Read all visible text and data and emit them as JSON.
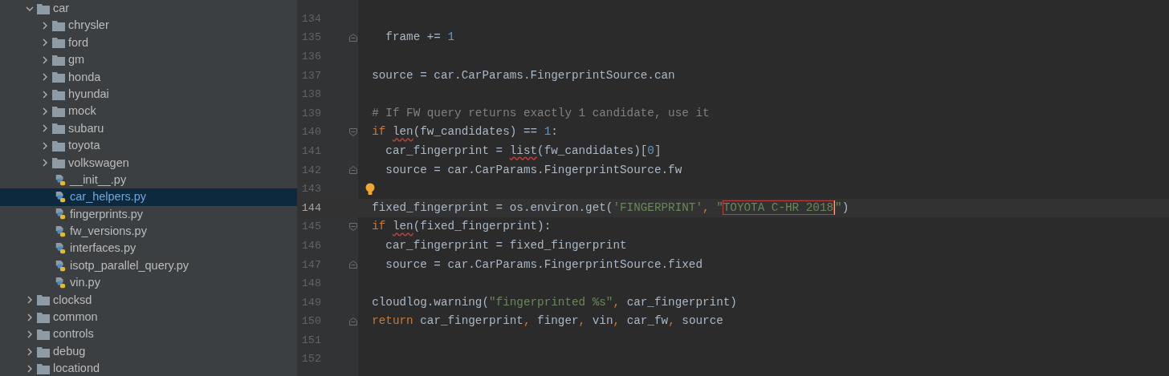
{
  "project_tree": [
    {
      "kind": "folder",
      "label": "car",
      "expanded": true,
      "selected": false,
      "children": [
        {
          "kind": "folder",
          "label": "chrysler",
          "expanded": false,
          "selected": false
        },
        {
          "kind": "folder",
          "label": "ford",
          "expanded": false,
          "selected": false
        },
        {
          "kind": "folder",
          "label": "gm",
          "expanded": false,
          "selected": false
        },
        {
          "kind": "folder",
          "label": "honda",
          "expanded": false,
          "selected": false
        },
        {
          "kind": "folder",
          "label": "hyundai",
          "expanded": false,
          "selected": false
        },
        {
          "kind": "folder",
          "label": "mock",
          "expanded": false,
          "selected": false
        },
        {
          "kind": "folder",
          "label": "subaru",
          "expanded": false,
          "selected": false
        },
        {
          "kind": "folder",
          "label": "toyota",
          "expanded": false,
          "selected": false
        },
        {
          "kind": "folder",
          "label": "volkswagen",
          "expanded": false,
          "selected": false
        },
        {
          "kind": "file",
          "label": "__init__.py",
          "selected": false
        },
        {
          "kind": "file",
          "label": "car_helpers.py",
          "selected": true
        },
        {
          "kind": "file",
          "label": "fingerprints.py",
          "selected": false
        },
        {
          "kind": "file",
          "label": "fw_versions.py",
          "selected": false
        },
        {
          "kind": "file",
          "label": "interfaces.py",
          "selected": false
        },
        {
          "kind": "file",
          "label": "isotp_parallel_query.py",
          "selected": false
        },
        {
          "kind": "file",
          "label": "vin.py",
          "selected": false
        }
      ]
    },
    {
      "kind": "folder",
      "label": "clocksd",
      "expanded": false,
      "selected": false
    },
    {
      "kind": "folder",
      "label": "common",
      "expanded": false,
      "selected": false
    },
    {
      "kind": "folder",
      "label": "controls",
      "expanded": false,
      "selected": false
    },
    {
      "kind": "folder",
      "label": "debug",
      "expanded": false,
      "selected": false
    },
    {
      "kind": "folder",
      "label": "locationd",
      "expanded": false,
      "selected": false
    }
  ],
  "editor": {
    "lines": [
      {
        "number": "134",
        "current": false
      },
      {
        "number": "135",
        "current": false,
        "fold_marker": {
          "kind": "end"
        },
        "tokens": [
          {
            "kind": "plain",
            "text": "    frame += "
          },
          {
            "kind": "number",
            "text": "1"
          }
        ]
      },
      {
        "number": "136",
        "current": false
      },
      {
        "number": "137",
        "current": false,
        "tokens": [
          {
            "kind": "plain",
            "text": "  source = car.CarParams.FingerprintSource.can"
          }
        ]
      },
      {
        "number": "138",
        "current": false
      },
      {
        "number": "139",
        "current": false,
        "tokens": [
          {
            "kind": "comment",
            "text": "  # If FW query returns exactly 1 candidate, use it"
          }
        ]
      },
      {
        "number": "140",
        "current": false,
        "fold_marker": {
          "kind": "start"
        },
        "tokens": [
          {
            "kind": "keyword",
            "text": "  if "
          },
          {
            "kind": "warned",
            "text": "len"
          },
          {
            "kind": "plain",
            "text": "(fw_candidates) == "
          },
          {
            "kind": "number",
            "text": "1"
          },
          {
            "kind": "plain",
            "text": ":"
          }
        ]
      },
      {
        "number": "141",
        "current": false,
        "tokens": [
          {
            "kind": "plain",
            "text": "    car_fingerprint = "
          },
          {
            "kind": "warned",
            "text": "list"
          },
          {
            "kind": "plain",
            "text": "(fw_candidates)["
          },
          {
            "kind": "number",
            "text": "0"
          },
          {
            "kind": "plain",
            "text": "]"
          }
        ]
      },
      {
        "number": "142",
        "current": false,
        "fold_marker": {
          "kind": "end"
        },
        "tokens": [
          {
            "kind": "plain",
            "text": "    source = car.CarParams.FingerprintSource.fw"
          }
        ]
      },
      {
        "number": "143",
        "current": false,
        "hint": true
      },
      {
        "number": "144",
        "current": true,
        "tokens": [
          {
            "kind": "plain",
            "text": "  fixed_fingerprint = os.environ.get("
          },
          {
            "kind": "string",
            "text": "'FINGERPRINT'"
          },
          {
            "kind": "keyword",
            "text": ", "
          },
          {
            "kind": "string",
            "text": "\""
          },
          {
            "kind": "flagged",
            "text": "TOYOTA C-HR 2018",
            "caret_after": true
          },
          {
            "kind": "string",
            "text": "\""
          },
          {
            "kind": "plain",
            "text": ")"
          }
        ]
      },
      {
        "number": "145",
        "current": false,
        "fold_marker": {
          "kind": "start"
        },
        "tokens": [
          {
            "kind": "keyword",
            "text": "  if "
          },
          {
            "kind": "warned",
            "text": "len"
          },
          {
            "kind": "plain",
            "text": "(fixed_fingerprint):"
          }
        ]
      },
      {
        "number": "146",
        "current": false,
        "tokens": [
          {
            "kind": "plain",
            "text": "    car_fingerprint = fixed_fingerprint"
          }
        ]
      },
      {
        "number": "147",
        "current": false,
        "fold_marker": {
          "kind": "end"
        },
        "tokens": [
          {
            "kind": "plain",
            "text": "    source = car.CarParams.FingerprintSource.fixed"
          }
        ]
      },
      {
        "number": "148",
        "current": false
      },
      {
        "number": "149",
        "current": false,
        "tokens": [
          {
            "kind": "plain",
            "text": "  cloudlog.warning("
          },
          {
            "kind": "string",
            "text": "\"fingerprinted %s\""
          },
          {
            "kind": "keyword",
            "text": ", "
          },
          {
            "kind": "plain",
            "text": "car_fingerprint)"
          }
        ]
      },
      {
        "number": "150",
        "current": false,
        "fold_marker": {
          "kind": "end"
        },
        "tokens": [
          {
            "kind": "keyword",
            "text": "  return "
          },
          {
            "kind": "plain",
            "text": "car_fingerprint"
          },
          {
            "kind": "keyword",
            "text": ", "
          },
          {
            "kind": "plain",
            "text": "finger"
          },
          {
            "kind": "keyword",
            "text": ", "
          },
          {
            "kind": "plain",
            "text": "vin"
          },
          {
            "kind": "keyword",
            "text": ", "
          },
          {
            "kind": "plain",
            "text": "car_fw"
          },
          {
            "kind": "keyword",
            "text": ", "
          },
          {
            "kind": "plain",
            "text": "source"
          }
        ]
      },
      {
        "number": "151",
        "current": false
      },
      {
        "number": "152",
        "current": false
      }
    ]
  }
}
